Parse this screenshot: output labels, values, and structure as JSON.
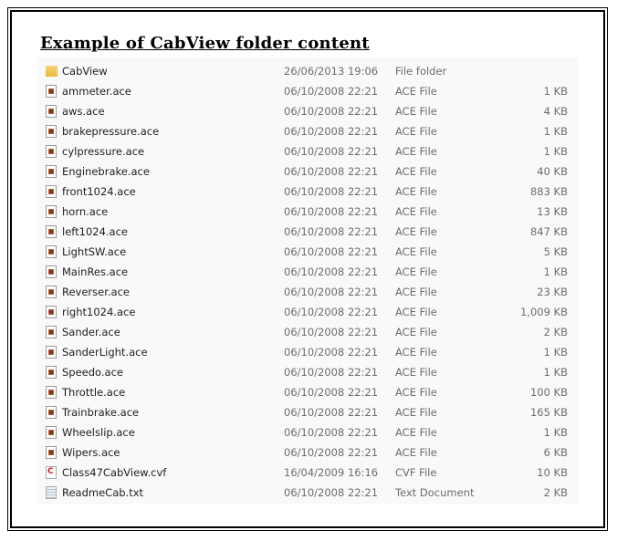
{
  "title": "Example of CabView folder content",
  "files": [
    {
      "name": "CabView",
      "date": "26/06/2013 19:06",
      "type": "File folder",
      "size": "",
      "icon": "folder"
    },
    {
      "name": "ammeter.ace",
      "date": "06/10/2008 22:21",
      "type": "ACE File",
      "size": "1 KB",
      "icon": "ace"
    },
    {
      "name": "aws.ace",
      "date": "06/10/2008 22:21",
      "type": "ACE File",
      "size": "4 KB",
      "icon": "ace"
    },
    {
      "name": "brakepressure.ace",
      "date": "06/10/2008 22:21",
      "type": "ACE File",
      "size": "1 KB",
      "icon": "ace"
    },
    {
      "name": "cylpressure.ace",
      "date": "06/10/2008 22:21",
      "type": "ACE File",
      "size": "1 KB",
      "icon": "ace"
    },
    {
      "name": "Enginebrake.ace",
      "date": "06/10/2008 22:21",
      "type": "ACE File",
      "size": "40 KB",
      "icon": "ace"
    },
    {
      "name": "front1024.ace",
      "date": "06/10/2008 22:21",
      "type": "ACE File",
      "size": "883 KB",
      "icon": "ace"
    },
    {
      "name": "horn.ace",
      "date": "06/10/2008 22:21",
      "type": "ACE File",
      "size": "13 KB",
      "icon": "ace"
    },
    {
      "name": "left1024.ace",
      "date": "06/10/2008 22:21",
      "type": "ACE File",
      "size": "847 KB",
      "icon": "ace"
    },
    {
      "name": "LightSW.ace",
      "date": "06/10/2008 22:21",
      "type": "ACE File",
      "size": "5 KB",
      "icon": "ace"
    },
    {
      "name": "MainRes.ace",
      "date": "06/10/2008 22:21",
      "type": "ACE File",
      "size": "1 KB",
      "icon": "ace"
    },
    {
      "name": "Reverser.ace",
      "date": "06/10/2008 22:21",
      "type": "ACE File",
      "size": "23 KB",
      "icon": "ace"
    },
    {
      "name": "right1024.ace",
      "date": "06/10/2008 22:21",
      "type": "ACE File",
      "size": "1,009 KB",
      "icon": "ace"
    },
    {
      "name": "Sander.ace",
      "date": "06/10/2008 22:21",
      "type": "ACE File",
      "size": "2 KB",
      "icon": "ace"
    },
    {
      "name": "SanderLight.ace",
      "date": "06/10/2008 22:21",
      "type": "ACE File",
      "size": "1 KB",
      "icon": "ace"
    },
    {
      "name": "Speedo.ace",
      "date": "06/10/2008 22:21",
      "type": "ACE File",
      "size": "1 KB",
      "icon": "ace"
    },
    {
      "name": "Throttle.ace",
      "date": "06/10/2008 22:21",
      "type": "ACE File",
      "size": "100 KB",
      "icon": "ace"
    },
    {
      "name": "Trainbrake.ace",
      "date": "06/10/2008 22:21",
      "type": "ACE File",
      "size": "165 KB",
      "icon": "ace"
    },
    {
      "name": "Wheelslip.ace",
      "date": "06/10/2008 22:21",
      "type": "ACE File",
      "size": "1 KB",
      "icon": "ace"
    },
    {
      "name": "Wipers.ace",
      "date": "06/10/2008 22:21",
      "type": "ACE File",
      "size": "6 KB",
      "icon": "ace"
    },
    {
      "name": "Class47CabView.cvf",
      "date": "16/04/2009 16:16",
      "type": "CVF File",
      "size": "10 KB",
      "icon": "cvf"
    },
    {
      "name": "ReadmeCab.txt",
      "date": "06/10/2008 22:21",
      "type": "Text Document",
      "size": "2 KB",
      "icon": "txt"
    }
  ]
}
